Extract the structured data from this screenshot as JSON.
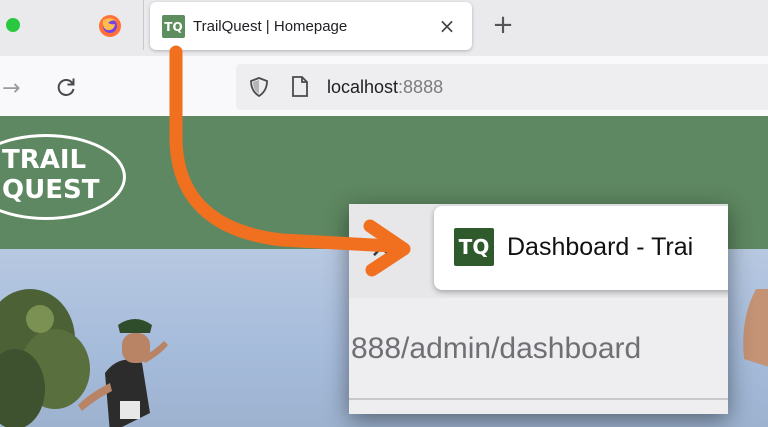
{
  "browser": {
    "tab": {
      "favicon_text": "TQ",
      "title": "TrailQuest | Homepage",
      "close_glyph": "×"
    },
    "new_tab_glyph": "+",
    "icons": [
      "firefox-icon",
      "forward-arrow-icon",
      "reload-icon",
      "shield-icon",
      "page-icon",
      "close-icon",
      "plus-icon"
    ],
    "url": {
      "host": "localhost",
      "port": ":8888"
    }
  },
  "site": {
    "logo_line1": "TRAIL",
    "logo_line2": "QUEST",
    "header_color": "#5e8861"
  },
  "callout": {
    "favicon_text": "TQ",
    "tab_title": "Dashboard - Trai",
    "url_fragment": "888/admin/dashboard",
    "arrow_color": "#f07020"
  }
}
